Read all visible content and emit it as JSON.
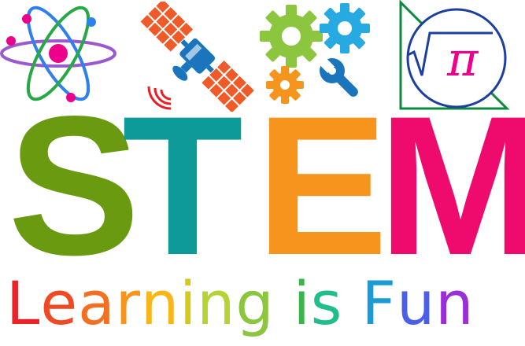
{
  "title": {
    "letters": [
      {
        "char": "S",
        "color": "#6a9a10"
      },
      {
        "char": "T",
        "color": "#0f9a9a"
      },
      {
        "char": "E",
        "color": "#f7941d"
      },
      {
        "char": "M",
        "color": "#ef0b6d"
      }
    ]
  },
  "tagline": {
    "letters": [
      {
        "char": "L",
        "color": "#e8232a"
      },
      {
        "char": "e",
        "color": "#ef4a23"
      },
      {
        "char": "a",
        "color": "#f36f21"
      },
      {
        "char": "r",
        "color": "#f7941d"
      },
      {
        "char": "n",
        "color": "#f9b619"
      },
      {
        "char": "i",
        "color": "#d6c91a"
      },
      {
        "char": "n",
        "color": "#b5d334"
      },
      {
        "char": "g",
        "color": "#8cc63f"
      },
      {
        "char": " ",
        "color": "#ffffff"
      },
      {
        "char": "i",
        "color": "#39b54a"
      },
      {
        "char": "s",
        "color": "#1fbe8a"
      },
      {
        "char": " ",
        "color": "#ffffff"
      },
      {
        "char": "F",
        "color": "#1b9bd6"
      },
      {
        "char": "u",
        "color": "#4a5ee8"
      },
      {
        "char": "n",
        "color": "#9b2fd6"
      }
    ]
  },
  "icons": {
    "atom": "atom-icon",
    "satellite": "satellite-icon",
    "gears": "gears-wrench-icon",
    "math": "sqrt-pi-icon",
    "sqrt_pi_text": "√π"
  },
  "colors": {
    "atom_orbit_purple": "#9b59d0",
    "atom_orbit_blue": "#2f80ed",
    "atom_orbit_green": "#27a844",
    "atom_nucleus": "#ec008c",
    "satellite_panel": "#f05a28",
    "satellite_body": "#1b75bc",
    "gear_green": "#8cc63f",
    "gear_blue": "#27aae1",
    "gear_orange": "#f7941d",
    "wrench_blue": "#1b75bc",
    "math_triangle": "#0b8a3e",
    "math_circle": "#1c3fa0",
    "math_pi": "#ec008c"
  }
}
